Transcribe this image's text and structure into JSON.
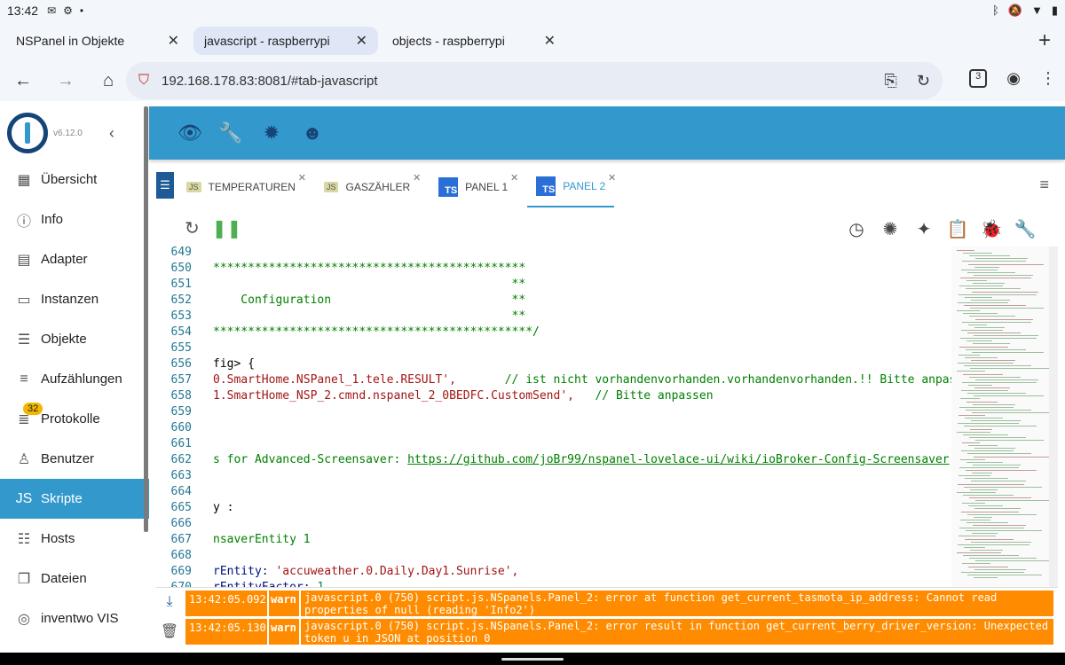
{
  "status_bar": {
    "time": "13:42"
  },
  "browser_tabs": [
    {
      "label": "NSPanel in Objekte",
      "active": false
    },
    {
      "label": "javascript - raspberrypi",
      "active": true
    },
    {
      "label": "objects - raspberrypi",
      "active": false
    }
  ],
  "address_bar": {
    "url": "192.168.178.83:8081/#tab-javascript",
    "tab_count": "3"
  },
  "app": {
    "version": "v6.12.0"
  },
  "sidebar": {
    "items": [
      {
        "label": "Übersicht",
        "icon": "grid-icon"
      },
      {
        "label": "Info",
        "icon": "info-icon"
      },
      {
        "label": "Adapter",
        "icon": "store-icon"
      },
      {
        "label": "Instanzen",
        "icon": "instances-icon"
      },
      {
        "label": "Objekte",
        "icon": "list-icon"
      },
      {
        "label": "Aufzählungen",
        "icon": "enum-icon"
      },
      {
        "label": "Protokolle",
        "icon": "log-icon",
        "badge": "32"
      },
      {
        "label": "Benutzer",
        "icon": "user-icon"
      },
      {
        "label": "Skripte",
        "icon": "js-icon",
        "active": true
      },
      {
        "label": "Hosts",
        "icon": "hosts-icon"
      },
      {
        "label": "Dateien",
        "icon": "files-icon"
      },
      {
        "label": "inventwo VIS",
        "icon": "vis-icon"
      }
    ]
  },
  "script_tabs": [
    {
      "label": "TEMPERATUREN",
      "kind": "js"
    },
    {
      "label": "GASZÄHLER",
      "kind": "js"
    },
    {
      "label": "PANEL 1",
      "kind": "ts"
    },
    {
      "label": "PANEL 2",
      "kind": "ts",
      "active": true
    }
  ],
  "editor": {
    "lines": [
      {
        "n": "649",
        "t": "",
        "c": "plain"
      },
      {
        "n": "650",
        "t": "*********************************************",
        "c": "comment"
      },
      {
        "n": "651",
        "t": "                                           **",
        "c": "comment"
      },
      {
        "n": "652",
        "t": "    Configuration                          **",
        "c": "comment"
      },
      {
        "n": "653",
        "t": "                                           **",
        "c": "comment"
      },
      {
        "n": "654",
        "t": "**********************************************/",
        "c": "comment"
      },
      {
        "n": "655",
        "t": "",
        "c": "plain"
      },
      {
        "n": "656",
        "t": "fig> {",
        "c": "plain"
      },
      {
        "n": "657",
        "t": "0.SmartHome.NSPanel_1.tele.RESULT',",
        "c": "str",
        "t2": "       // ist nicht vorhandenvorhanden.vorhandenvorhanden.!! Bitte anpassen"
      },
      {
        "n": "658",
        "t": "1.SmartHome_NSP_2.cmnd.nspanel_2_0BEDFC.CustomSend',",
        "c": "str",
        "t2": "   // Bitte anpassen"
      },
      {
        "n": "659",
        "t": "",
        "c": "plain"
      },
      {
        "n": "660",
        "t": "",
        "c": "plain"
      },
      {
        "n": "661",
        "t": "",
        "c": "plain"
      },
      {
        "n": "662",
        "t": "s for Advanced-Screensaver: ",
        "c": "comment",
        "link": "https://github.com/joBr99/nspanel-lovelace-ui/wiki/ioBroker-Config-Screensaver"
      },
      {
        "n": "663",
        "t": "",
        "c": "plain"
      },
      {
        "n": "664",
        "t": "",
        "c": "plain"
      },
      {
        "n": "665",
        "t": "y :",
        "c": "plain"
      },
      {
        "n": "666",
        "t": "",
        "c": "plain"
      },
      {
        "n": "667",
        "t": "nsaverEntity 1",
        "c": "comment"
      },
      {
        "n": "668",
        "t": "",
        "c": "plain"
      },
      {
        "n": "669",
        "t": "rEntity: ",
        "c": "prop",
        "t2": "'accuweather.0.Daily.Day1.Sunrise',",
        "c2": "str"
      },
      {
        "n": "670",
        "t": "rEntityFactor: ",
        "c": "prop",
        "t2": "1",
        "c2": "num"
      }
    ]
  },
  "log": [
    {
      "time": "13:42:05.092",
      "level": "warn",
      "message": "javascript.0 (750) script.js.NSpanels.Panel_2: error at function get_current_tasmota_ip_address: Cannot read properties of null (reading 'Info2')"
    },
    {
      "time": "13:42:05.130",
      "level": "warn",
      "message": "javascript.0 (750) script.js.NSpanels.Panel_2: error result in function get_current_berry_driver_version: Unexpected token u in JSON at position 0"
    }
  ],
  "colors": {
    "accent": "#3399cc",
    "logo": "#164477",
    "warn": "#ff8c00"
  }
}
